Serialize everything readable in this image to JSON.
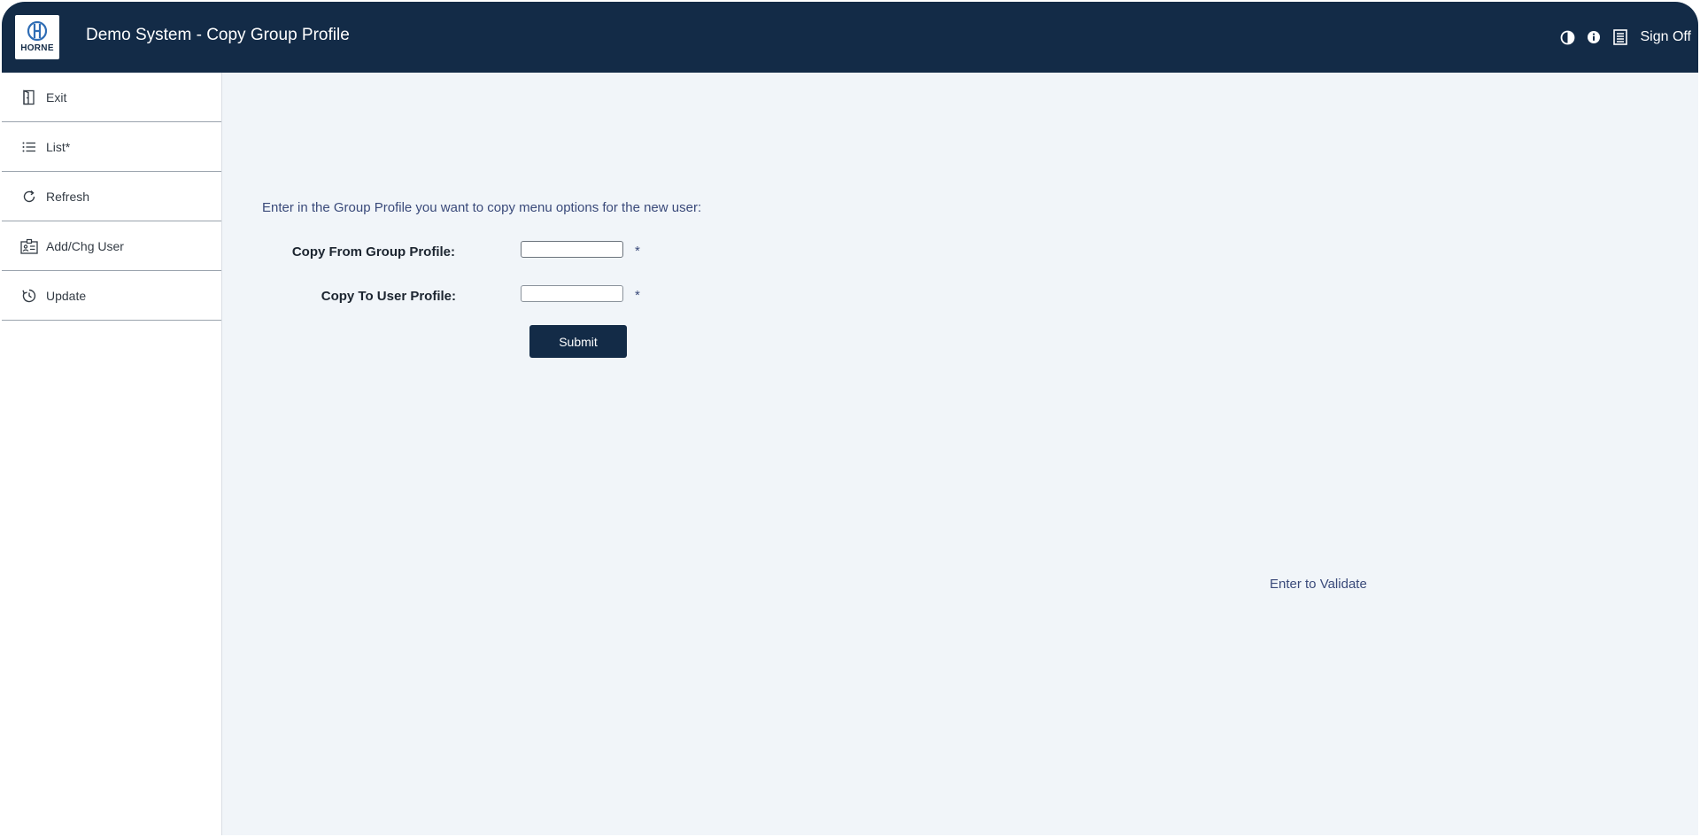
{
  "header": {
    "logo_text": "HORNE",
    "title": "Demo System - Copy Group Profile",
    "icons": [
      "contrast-icon",
      "info-icon",
      "list-document-icon"
    ],
    "sign_off_label": "Sign Off"
  },
  "sidebar": {
    "items": [
      {
        "label": "Exit",
        "icon": "door-exit-icon"
      },
      {
        "label": "List*",
        "icon": "list-icon"
      },
      {
        "label": "Refresh",
        "icon": "refresh-icon"
      },
      {
        "label": "Add/Chg User",
        "icon": "user-card-icon"
      },
      {
        "label": "Update",
        "icon": "history-icon"
      }
    ]
  },
  "form": {
    "instruction": "Enter in the Group Profile you want to copy menu options for the new user:",
    "copy_from_label": "Copy From Group Profile:",
    "copy_from_value": "",
    "copy_to_label": "Copy To User Profile:",
    "copy_to_value": "",
    "required_marker": "*",
    "submit_label": "Submit"
  },
  "hint": "Enter to Validate",
  "colors": {
    "header_bg": "#132b47",
    "main_bg": "#f1f5f9",
    "accent_text": "#3a4a7a"
  }
}
